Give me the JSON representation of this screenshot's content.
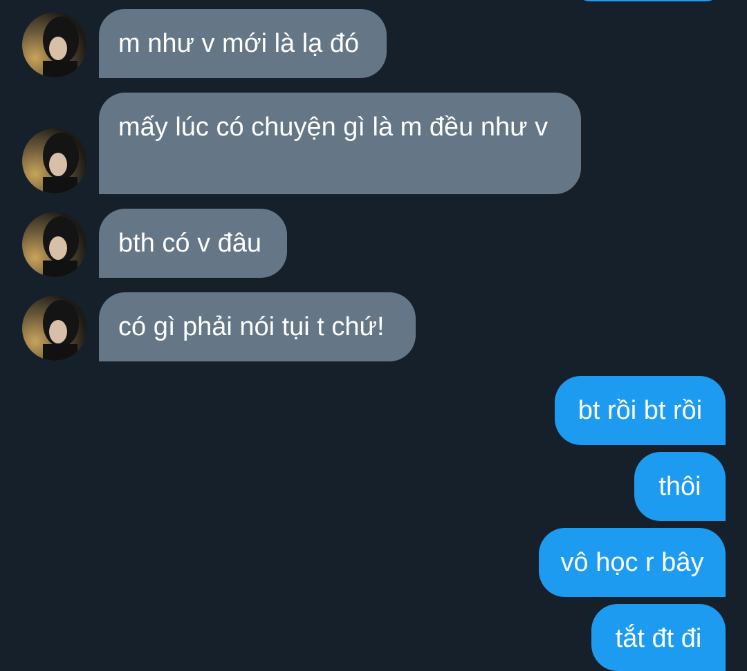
{
  "conversation": {
    "incoming": [
      {
        "text": "m như v mới là lạ đó"
      },
      {
        "text": "mấy lúc có chuyện gì là m đều như v"
      },
      {
        "text": "bth có v đâu"
      },
      {
        "text": "có gì phải nói tụi t chứ!"
      }
    ],
    "outgoing": [
      {
        "text": "bt rồi bt rồi"
      },
      {
        "text": "thôi"
      },
      {
        "text": "vô học r bây"
      },
      {
        "text": "tắt đt đi"
      }
    ]
  },
  "colors": {
    "background": "#16202a",
    "incoming_bubble": "#657786",
    "outgoing_bubble": "#1d9bf0",
    "text": "#ffffff"
  }
}
